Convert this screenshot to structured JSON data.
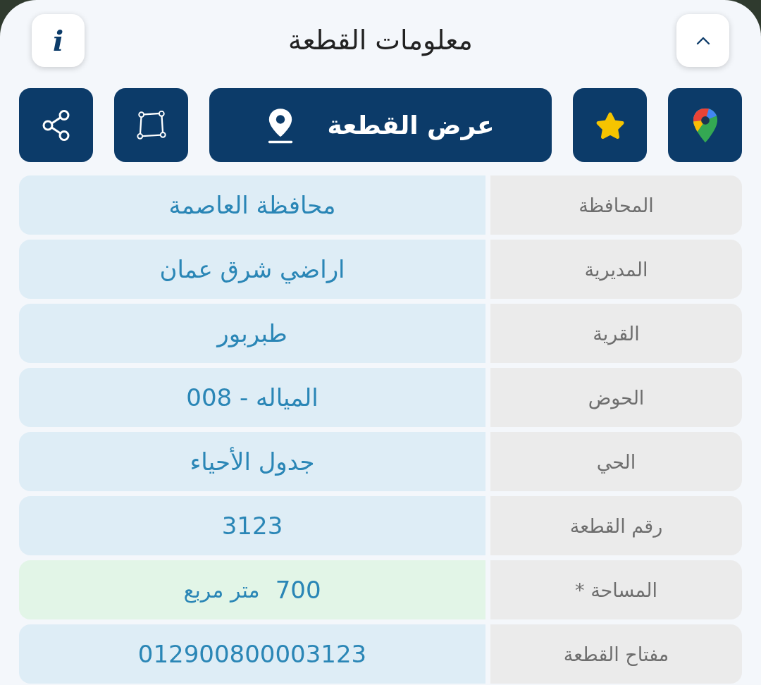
{
  "header": {
    "title": "معلومات القطعة",
    "info_button": {
      "label": "i"
    }
  },
  "actions": [
    {
      "kind": "maps"
    },
    {
      "kind": "favorite"
    },
    {
      "kind": "show",
      "label": "عرض القطعة"
    },
    {
      "kind": "boundary"
    },
    {
      "kind": "share"
    }
  ],
  "rows": [
    {
      "label": "المحافظة",
      "value": "محافظة العاصمة",
      "highlighted": false
    },
    {
      "label": "المديرية",
      "value": "اراضي شرق عمان",
      "highlighted": false
    },
    {
      "label": "القرية",
      "value": "طبربور",
      "highlighted": false
    },
    {
      "label": "الحوض",
      "value": "المياله - 008",
      "highlighted": false
    },
    {
      "label": "الحي",
      "value": "جدول الأحياء",
      "highlighted": false
    },
    {
      "label": "رقم القطعة",
      "value": "3123",
      "highlighted": false
    },
    {
      "label": "المساحة *",
      "value": "700",
      "unit": "متر مربع",
      "highlighted": true
    },
    {
      "label": "مفتاح القطعة",
      "value": "012900800003123",
      "highlighted": false
    }
  ]
}
